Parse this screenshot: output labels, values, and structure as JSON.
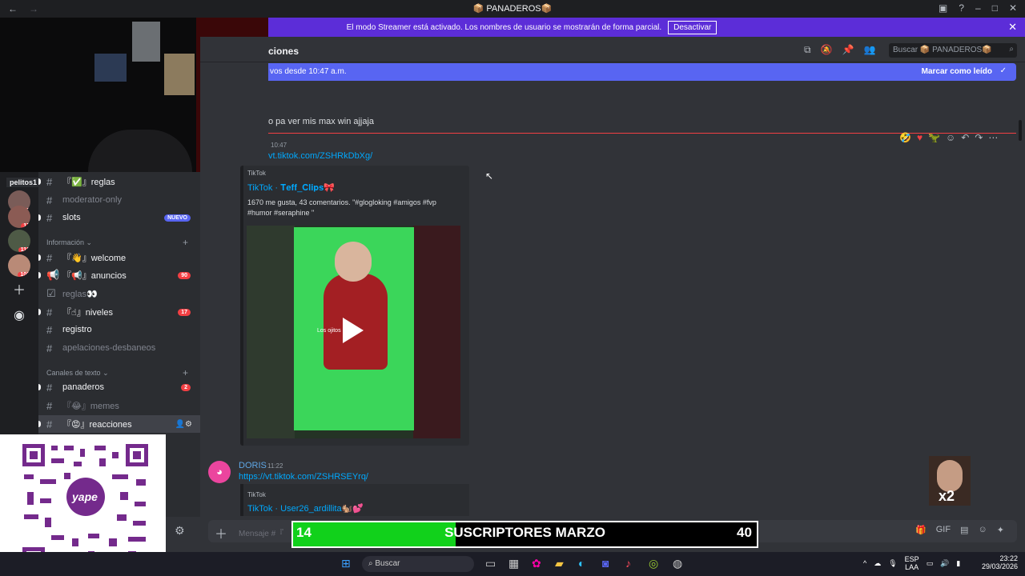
{
  "titlebar": {
    "title": "📦 PANADEROS📦"
  },
  "streamer": {
    "notice": "El modo Streamer está activado. Los nombres de usuario se mostrarán de forma parcial.",
    "button": "Desactivar"
  },
  "servers": [
    {
      "badge": "26"
    },
    {
      "badge": "17"
    },
    {
      "badge": "110"
    },
    {
      "badge": "102"
    }
  ],
  "sidebar": {
    "user_tag": "pelitos1",
    "channels": [
      {
        "label": "『✅』reglas"
      },
      {
        "label": "moderator-only"
      },
      {
        "label": "slots",
        "badge": "NUEVO"
      },
      {
        "category": "Información"
      },
      {
        "label": "『👋』welcome"
      },
      {
        "label": "『📢』anuncios",
        "count": "90"
      },
      {
        "label": "reglas👀"
      },
      {
        "label": "『☝』niveles",
        "count": "17"
      },
      {
        "label": "registro"
      },
      {
        "label": "apelaciones-desbaneos"
      },
      {
        "category": "Canales de texto"
      },
      {
        "label": "panaderos",
        "count": "2"
      },
      {
        "label": "『😂』memes"
      },
      {
        "label": "『😡』reacciones"
      }
    ]
  },
  "header": {
    "title": "ciones",
    "search_placeholder": "Buscar 📦 PANADEROS📦"
  },
  "newbar": {
    "text": "vos desde 10:47 a.m.",
    "mark_read": "Marcar como leído"
  },
  "messages": {
    "partial": "o pa ver mis max win ajjaja",
    "time1": "10:47",
    "link1": "vt.tiktok.com/ZSHRkDbXg/",
    "embed1_site": "TikTok",
    "embed1_title": "TikTok · 𝐓𝐞𝐟𝐟_𝐂𝐥𝐢𝐩𝐬🎀",
    "embed1_desc": "1670 me gusta, 43 comentarios. \"#glogloking #amigos #fvp #humor #seraphine \"",
    "video_caption": "Los ojitos",
    "author2": "DORIS",
    "time2": "11:22",
    "link2": "https://vt.tiktok.com/ZSHRSEYrq/",
    "embed2_site": "TikTok",
    "embed2_title": "TikTok · User26_ardillita🐿️💕"
  },
  "composer": {
    "placeholder": "Mensaje #『"
  },
  "subs_bar": {
    "current": "14",
    "label": "SUSCRIPTORES MARZO",
    "goal": "40",
    "progress": 0.35
  },
  "x2_badge": "x2",
  "taskbar": {
    "search": "Buscar",
    "lang": "ESP",
    "lang2": "LAA",
    "time": "23:22",
    "date": "29/03/2026"
  },
  "colors": {
    "accent": "#5865f2",
    "streamer": "#5c2dd8",
    "danger": "#f23f43",
    "sub_fill": "#11d11b"
  }
}
